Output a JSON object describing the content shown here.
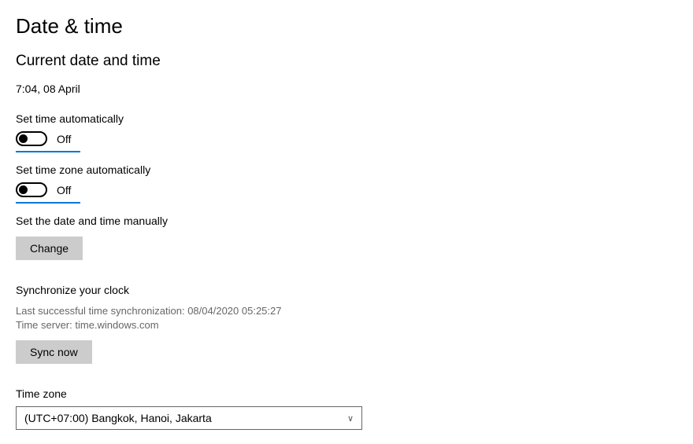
{
  "title": "Date & time",
  "current": {
    "heading": "Current date and time",
    "value": "7:04, 08 April"
  },
  "autoTime": {
    "label": "Set time automatically",
    "state": "Off"
  },
  "autoZone": {
    "label": "Set time zone automatically",
    "state": "Off"
  },
  "manual": {
    "label": "Set the date and time manually",
    "button": "Change"
  },
  "sync": {
    "heading": "Synchronize your clock",
    "lastLine": "Last successful time synchronization: 08/04/2020 05:25:27",
    "serverLine": "Time server: time.windows.com",
    "button": "Sync now"
  },
  "timezone": {
    "label": "Time zone",
    "selected": "(UTC+07:00) Bangkok, Hanoi, Jakarta"
  }
}
